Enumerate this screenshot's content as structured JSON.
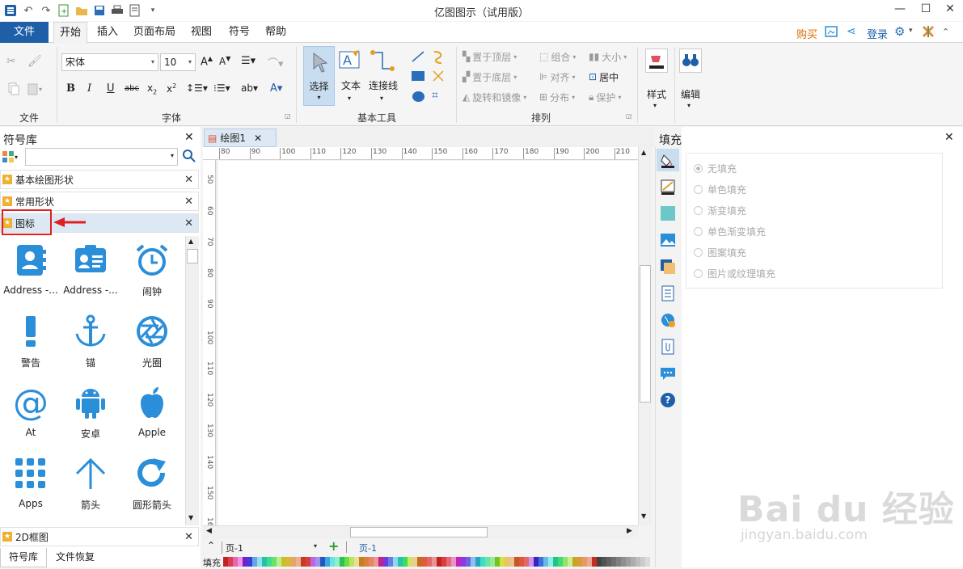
{
  "app": {
    "title": "亿图图示（试用版）"
  },
  "menu": {
    "file": "文件",
    "tabs": [
      "开始",
      "插入",
      "页面布局",
      "视图",
      "符号",
      "帮助"
    ],
    "buy": "购买",
    "login": "登录"
  },
  "ribbon": {
    "groups": {
      "file": "文件",
      "font": "字体",
      "basic_tools": "基本工具",
      "arrange": "排列"
    },
    "font_name": "宋体",
    "font_size": "10",
    "tools": {
      "select": "选择",
      "text": "文本",
      "connector": "连接线"
    },
    "arrange": {
      "bring_front": "置于顶层",
      "send_back": "置于底层",
      "rotate": "旋转和镜像",
      "group": "组合",
      "align": "对齐",
      "distribute": "分布",
      "size": "大小",
      "center": "居中",
      "protect": "保护"
    },
    "style": "样式",
    "edit": "编辑"
  },
  "library": {
    "title": "符号库",
    "categories": [
      "基本绘图形状",
      "常用形状",
      "图标"
    ],
    "bottom_category": "2D框图",
    "shapes": [
      "Address -...",
      "Address -...",
      "闹钟",
      "警告",
      "锚",
      "光圈",
      "At",
      "安卓",
      "Apple",
      "Apps",
      "箭头",
      "圆形箭头"
    ],
    "bottom_tabs": [
      "符号库",
      "文件恢复"
    ]
  },
  "document": {
    "tab": "绘图1",
    "page_select": "页-1",
    "page_tab": "页-1",
    "fill_label": "填充"
  },
  "ruler": {
    "h": [
      "80",
      "90",
      "100",
      "110",
      "120",
      "130",
      "140",
      "150",
      "160",
      "170",
      "180",
      "190",
      "200",
      "210"
    ],
    "v": [
      "50",
      "60",
      "70",
      "80",
      "90",
      "100",
      "110",
      "120",
      "130",
      "140",
      "150",
      "160"
    ]
  },
  "fill_panel": {
    "title": "填充",
    "options": [
      "无填充",
      "单色填充",
      "渐变填充",
      "单色渐变填充",
      "图案填充",
      "图片或纹理填充"
    ]
  },
  "watermark": {
    "brand": "Bai du 经验",
    "url": "jingyan.baidu.com"
  },
  "colors": {
    "accent": "#1f5fa8",
    "icon_blue": "#2b8ed8",
    "star": "#f0b030",
    "highlight_red": "#e02020"
  }
}
